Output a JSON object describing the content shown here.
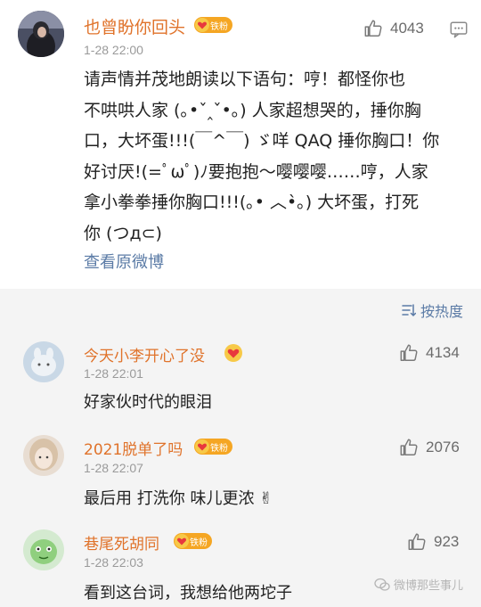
{
  "main_post": {
    "username": "也曾盼你回头",
    "badge": "铁粉",
    "time": "1-28 22:00",
    "likes": "4043",
    "text_lines": [
      "请声情并茂地朗读以下语句：哼！都怪你也",
      "不哄哄人家 (｡•ˇ‸ˇ•｡) 人家超想哭的，捶你胸",
      "口，大坏蛋!!!(￣^￣) ゞ咩 QAQ 捶你胸口！你",
      "好讨厌!(=ﾟωﾟ)ﾉ要抱抱～嘤嘤嘤……哼，人家",
      "拿小拳拳捶你胸口!!!(｡• ︿•̀｡) 大坏蛋，打死",
      "你 (つд⊂)"
    ],
    "view_original": "查看原微博"
  },
  "sort_label": "按热度",
  "comments": [
    {
      "username": "今天小李开心了没",
      "badge": "",
      "time": "1-28 22:01",
      "likes": "4134",
      "text": "好家伙时代的眼泪"
    },
    {
      "username": "2021脱单了吗",
      "badge": "铁粉",
      "time": "1-28 22:07",
      "likes": "2076",
      "text": "最后用 打洗你 味儿更浓 ✌"
    },
    {
      "username": "巷尾死胡同",
      "badge": "铁粉",
      "time": "1-28 22:03",
      "likes": "923",
      "text": "看到这台词，我想给他两坨子"
    }
  ],
  "watermark": "微博那些事儿",
  "colors": {
    "username": "#e0732b",
    "link": "#5b7ba6",
    "badge": "#f5a623",
    "background_gray": "#f4f4f4"
  },
  "icons": [
    "thumbs-up-icon",
    "share-icon",
    "sort-icon",
    "heart-badge-icon",
    "wechat-icon"
  ]
}
